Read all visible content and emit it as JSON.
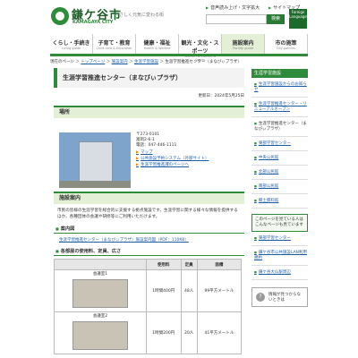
{
  "header": {
    "logo_title": "鎌ケ谷市",
    "logo_sub": "KAMAGAYA CITY",
    "tagline": "やさしく元気に変わる街",
    "links": [
      "音声読み上げ・文字拡大",
      "サイトマップ"
    ],
    "search_label": "検索",
    "foreign_label": "Foreign Language"
  },
  "nav": [
    {
      "ja": "くらし・手続き",
      "en": "Living guide"
    },
    {
      "ja": "子育て・教育",
      "en": "Child care & Education"
    },
    {
      "ja": "健康・福祉",
      "en": "Health & Welfare"
    },
    {
      "ja": "観光・文化・スポーツ",
      "en": "Tourism & Culture & Sports"
    },
    {
      "ja": "施設案内",
      "en": "Facility guide"
    },
    {
      "ja": "市の施策",
      "en": "City policies"
    }
  ],
  "breadcrumb": {
    "items": [
      "現在のページ",
      "トップページ",
      "施設案内",
      "生涯学習施設"
    ],
    "current": "生涯学習推進センター（まなびぃプラザ）"
  },
  "main": {
    "title": "生涯学習推進センター（まなびぃプラザ）",
    "updated": "更新日：2024年5月25日",
    "section_location": "場所",
    "address": [
      "〒273-0101",
      "富岡2-6-1",
      "電話：047-446-1111"
    ],
    "links": [
      "マップ",
      "公共施設予約システム（外部サイト）",
      "生涯学習推進課のページへ"
    ],
    "section_facility": "施設案内",
    "description": "市民の皆様の生涯学習を総合的に支援する拠点施設です。生涯学習に関する様々な情報を提供するほか、各種団体の会議や研修等にご利用いただけます。",
    "h3_guide": "案内図",
    "pdf_link": "生涯学習推進センター（まなびぃプラザ）施設案内図（PDF：110KB）",
    "h3_rooms": "各部屋の使用料、定員、広さ",
    "table_headers": [
      "",
      "使用料",
      "定員",
      "面積"
    ],
    "rooms": [
      {
        "name": "会議室1",
        "fee": "1時間400円",
        "capacity": "48人",
        "area": "99平方メートル"
      },
      {
        "name": "会議室2",
        "fee": "1時間200円",
        "capacity": "20人",
        "area": "41平方メートル"
      }
    ]
  },
  "sidebar": {
    "header": "生涯学習施設",
    "items": [
      "生涯学習施設からのお知らせ",
      "生涯学習推進センター・リニューアルオープン",
      "生涯学習推進センター（まなびぃプラザ）",
      "東部学習センター",
      "中央公民館",
      "北部公民館",
      "南部公民館",
      "郷土資料館"
    ],
    "box_text": "このページを見ている人はこんなページも見ています",
    "box_links": [
      "東部学習センター",
      "鎌ケ谷市公共施設LAN利用規約",
      "鎌ケ谷大仏駅周辺"
    ],
    "faq": "情報が見つからないときは"
  }
}
